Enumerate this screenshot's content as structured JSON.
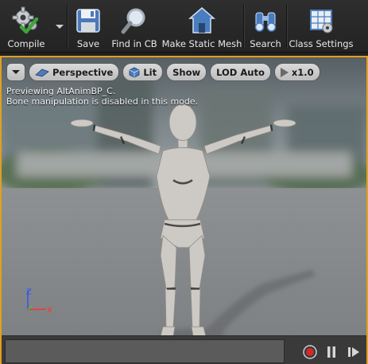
{
  "toolbar": {
    "compile_label": "Compile",
    "save_label": "Save",
    "find_label": "Find in CB",
    "static_mesh_label": "Make Static Mesh",
    "search_label": "Search",
    "class_settings_label": "Class Settings"
  },
  "viewport": {
    "perspective_label": "Perspective",
    "lit_label": "Lit",
    "show_label": "Show",
    "lod_label": "LOD Auto",
    "speed_label": "x1.0",
    "info_line1": "Previewing AltAnimBP_C.",
    "info_line2": "Bone manipulation is disabled in this mode.",
    "axis_z": "Z",
    "axis_x": "X",
    "accent_color": "#e0a020"
  },
  "playback": {
    "record_icon": "record-icon",
    "pause_icon": "pause-icon",
    "step_icon": "step-forward-icon"
  }
}
